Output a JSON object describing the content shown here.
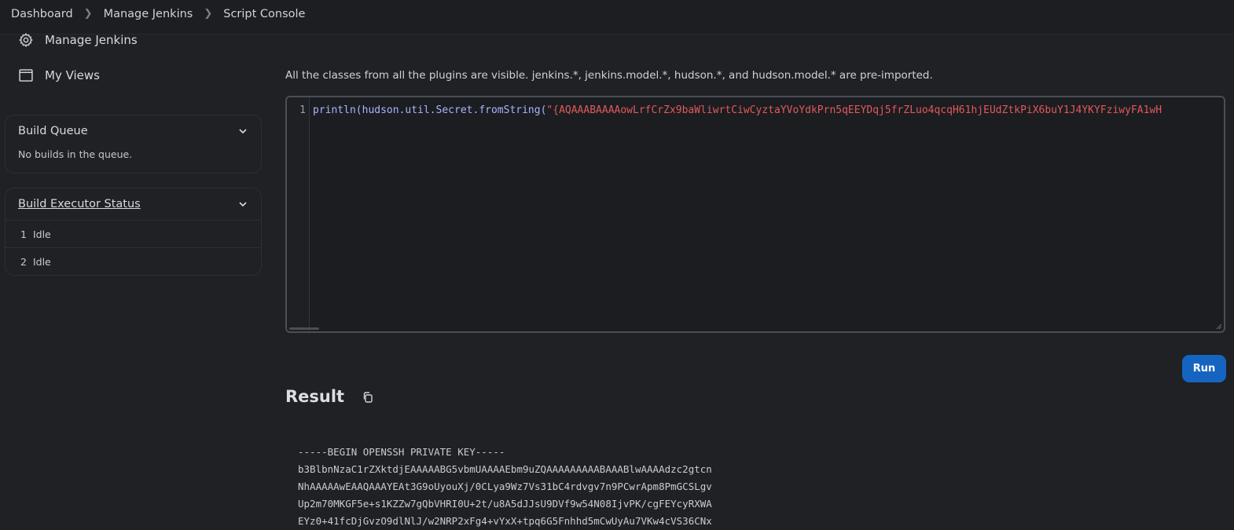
{
  "breadcrumb": [
    "Dashboard",
    "Manage Jenkins",
    "Script Console"
  ],
  "sidebar": {
    "links": [
      {
        "label": "Manage Jenkins",
        "icon": "gear-icon"
      },
      {
        "label": "My Views",
        "icon": "window-icon"
      }
    ],
    "build_queue": {
      "title": "Build Queue",
      "empty_text": "No builds in the queue."
    },
    "executor_status": {
      "title": "Build Executor Status",
      "executors": [
        {
          "num": "1",
          "state": "Idle"
        },
        {
          "num": "2",
          "state": "Idle"
        }
      ]
    }
  },
  "main": {
    "description": "All the classes from all the plugins are visible. jenkins.*, jenkins.model.*, hudson.*, and hudson.model.* are pre-imported.",
    "editor": {
      "line_number": "1",
      "code_call": "println(hudson.util.Secret.fromString(",
      "code_string": "\"{AQAAABAAAAowLrfCrZx9baWliwrtCiwCyztaYVoYdkPrn5qEEYDqj5frZLuo4qcqH61hjEUdZtkPiX6buY1J4YKYFziwyFA1wH"
    },
    "run_label": "Run",
    "result_title": "Result",
    "result_lines": [
      "-----BEGIN OPENSSH PRIVATE KEY-----",
      "b3BlbnNzaC1rZXktdjEAAAAABG5vbmUAAAAEbm9uZQAAAAAAAAABAAABlwAAAAdzc2gtcn",
      "NhAAAAAwEAAQAAAYEAt3G9oUyouXj/0CLya9Wz7Vs31bC4rdvgv7n9PCwrApm8PmGCSLgv",
      "Up2m70MKGF5e+s1KZZw7gQbVHRI0U+2t/u8A5dJJsU9DVf9w54N08IjvPK/cgFEYcyRXWA",
      "EYz0+41fcDjGvzO9dlNlJ/w2NRP2xFg4+vYxX+tpq6G5Fnhhd5mCwUyAu7VKw4cVS36CNx"
    ]
  },
  "colors": {
    "accent": "#1565c0",
    "string": "#e2595b",
    "background": "#1f2125"
  }
}
